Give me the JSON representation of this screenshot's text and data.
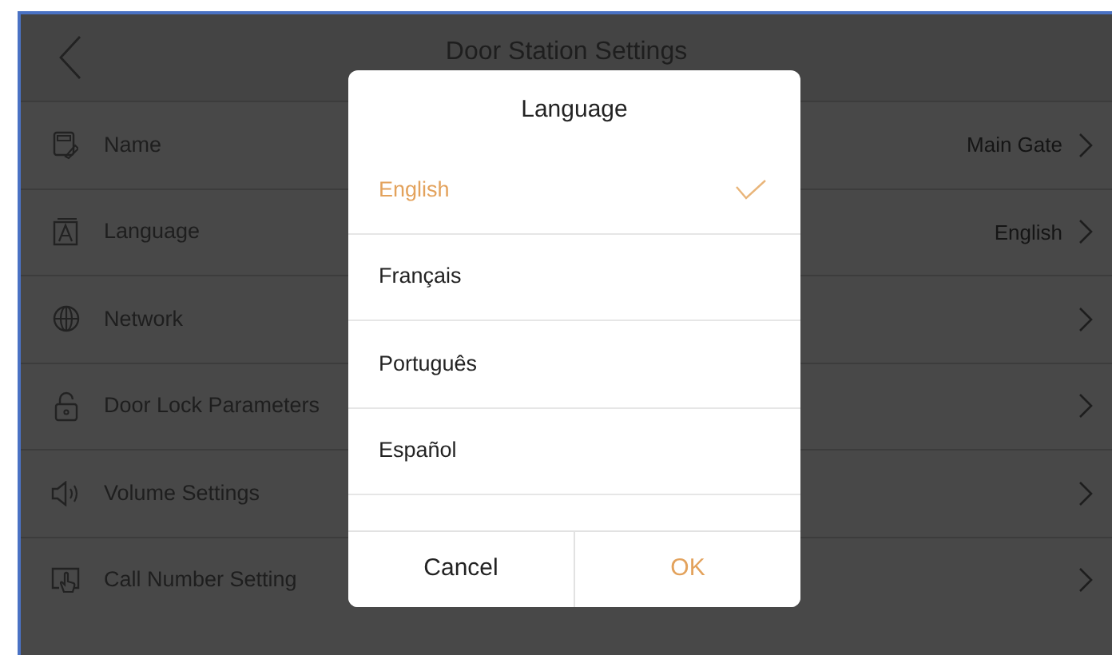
{
  "header": {
    "title": "Door Station Settings"
  },
  "settings": [
    {
      "kind": "name",
      "label": "Name",
      "value": "Main Gate"
    },
    {
      "kind": "language",
      "label": "Language",
      "value": "English"
    },
    {
      "kind": "network",
      "label": "Network"
    },
    {
      "kind": "lock",
      "label": "Door Lock Parameters"
    },
    {
      "kind": "volume",
      "label": "Volume Settings"
    },
    {
      "kind": "call",
      "label": "Call Number Setting"
    }
  ],
  "language_dialog": {
    "title": "Language",
    "options": [
      {
        "label": "English",
        "selected": true
      },
      {
        "label": "Français",
        "selected": false
      },
      {
        "label": "Português",
        "selected": false
      },
      {
        "label": "Español",
        "selected": false
      }
    ],
    "buttons": [
      {
        "kind": "cancel",
        "label": "Cancel"
      },
      {
        "kind": "ok",
        "label": "OK"
      }
    ]
  }
}
